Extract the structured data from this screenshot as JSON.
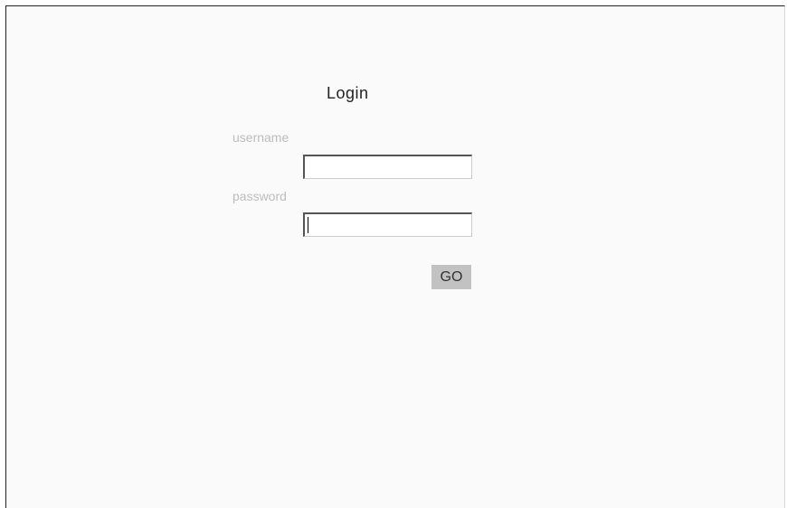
{
  "login": {
    "title": "Login",
    "username_label": "username",
    "username_value": "",
    "password_label": "password",
    "password_value": "",
    "submit_label": "GO"
  },
  "colors": {
    "background": "#fafafa",
    "label_text": "#bdbdbd",
    "button_bg": "#c2c2c2"
  }
}
